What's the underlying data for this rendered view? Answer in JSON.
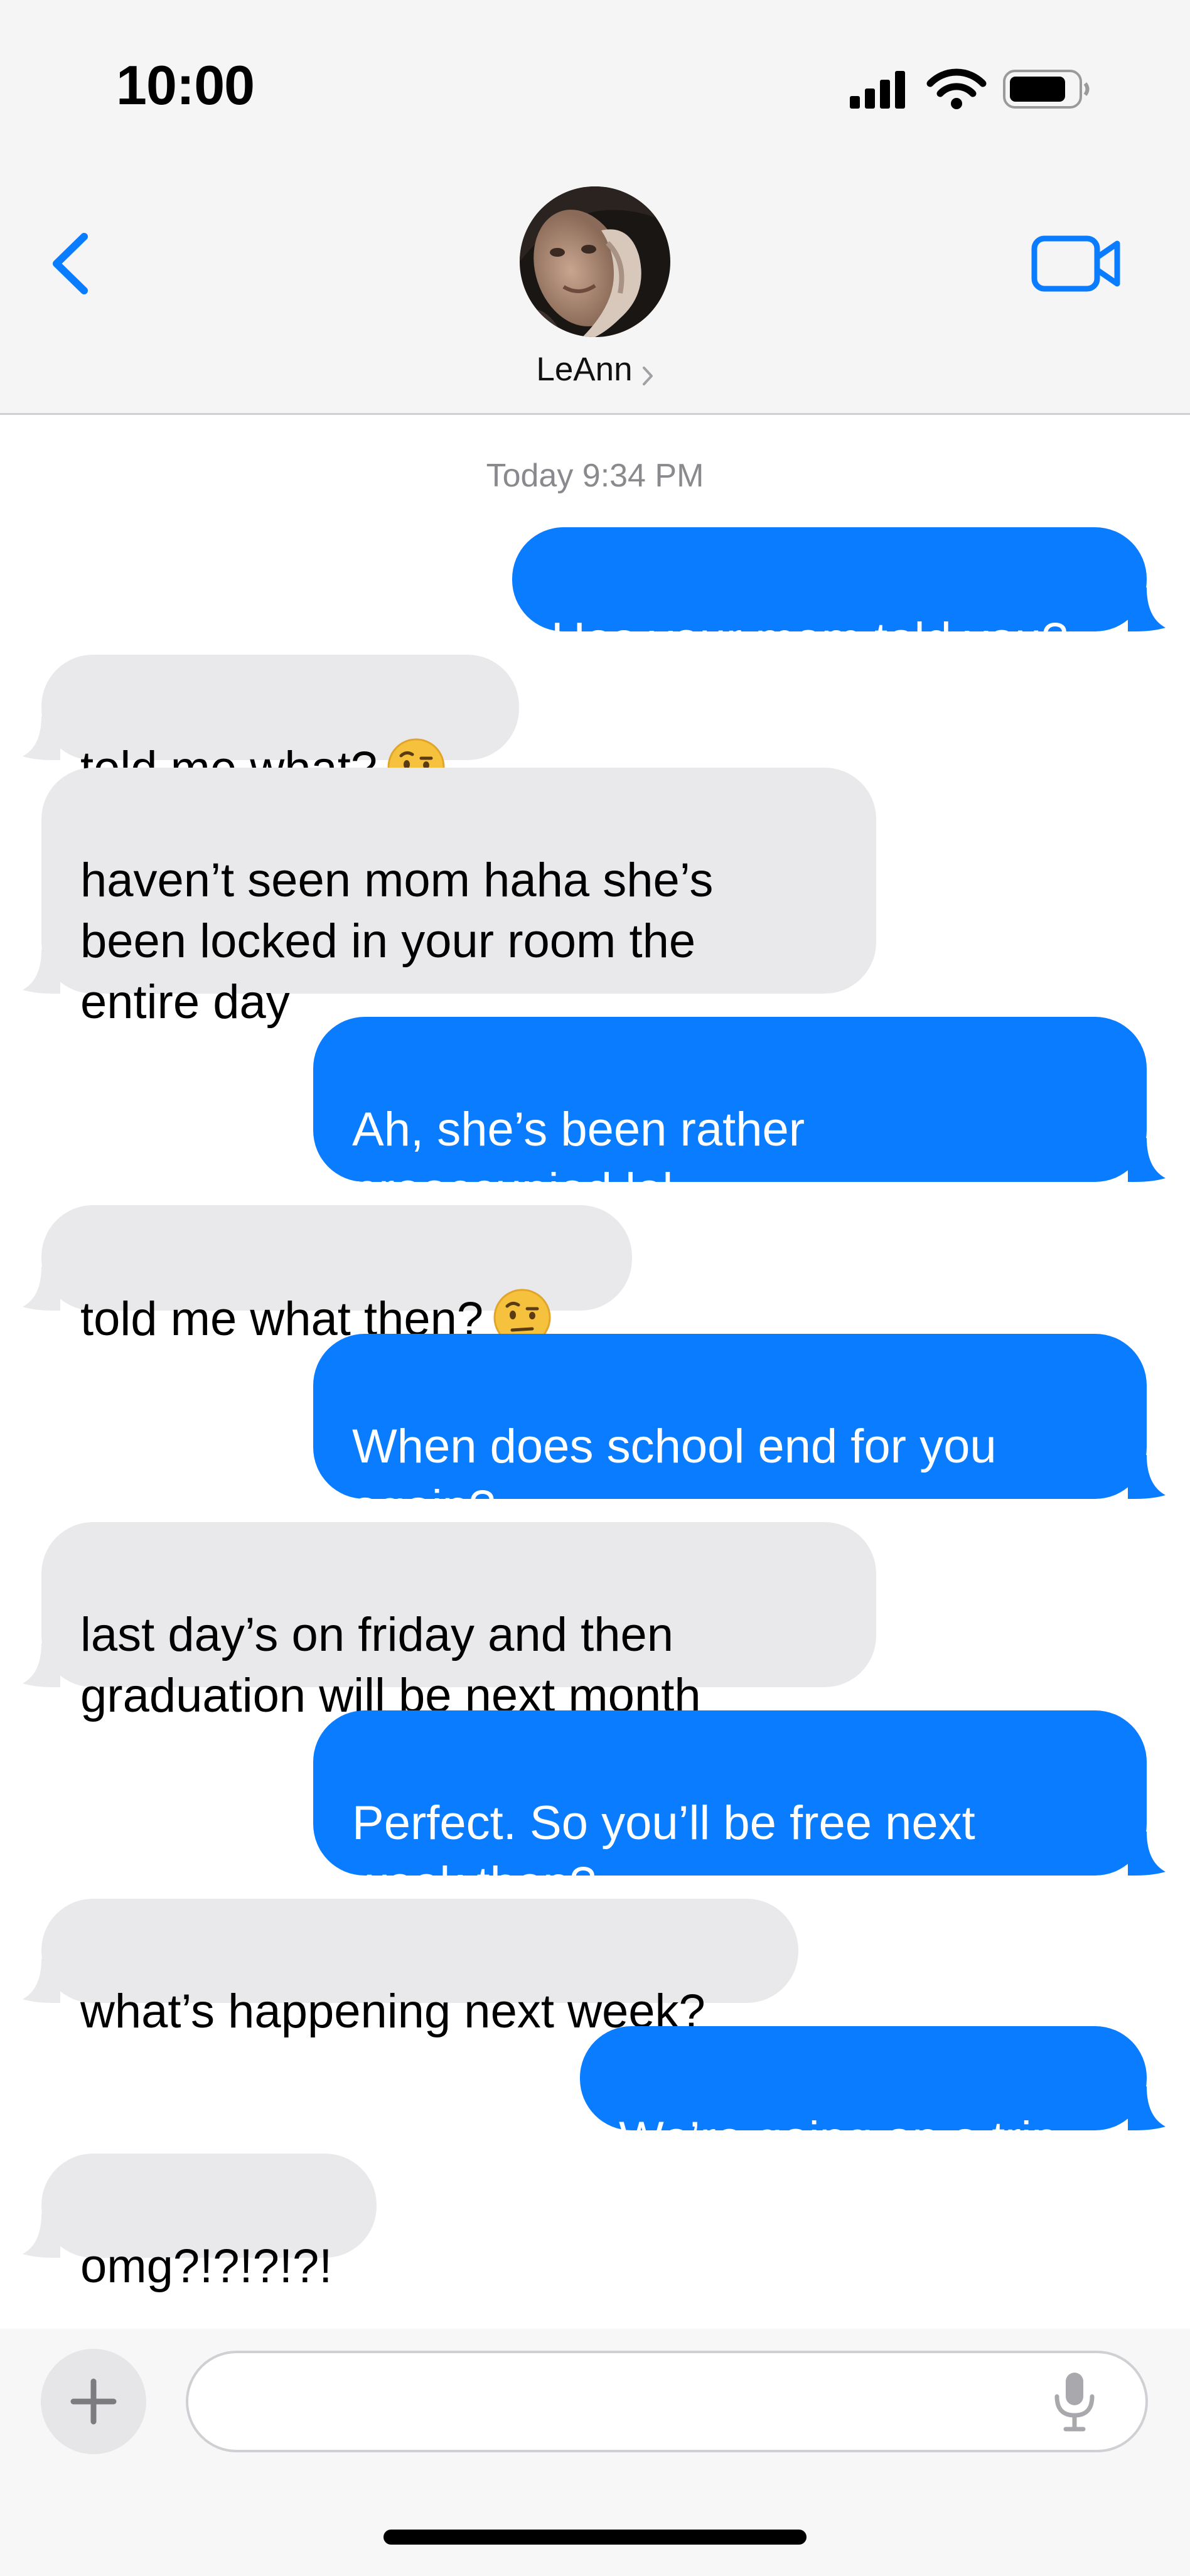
{
  "status_bar": {
    "time": "10:00",
    "icons": [
      "cellular-signal-icon",
      "wifi-icon",
      "battery-icon"
    ]
  },
  "header": {
    "back_icon": "chevron-left-icon",
    "contact_name": "LeAnn",
    "video_icon": "video-camera-icon"
  },
  "thread": {
    "timestamp": "Today 9:34 PM",
    "messages": [
      {
        "sender": "me",
        "text": "Has your mom told you?"
      },
      {
        "sender": "them",
        "text": "told me what?",
        "emoji": "raised-eyebrow-face"
      },
      {
        "sender": "them",
        "text": "haven’t seen mom haha she’s\nbeen locked in your room the\nentire day"
      },
      {
        "sender": "me",
        "text": "Ah, she’s been rather\npreoccupied lol."
      },
      {
        "sender": "them",
        "text": "told me what then?",
        "emoji": "raised-eyebrow-face"
      },
      {
        "sender": "me",
        "text": "When does school end for you\nagain?"
      },
      {
        "sender": "them",
        "text": "last day’s on friday and then\ngraduation will be next month"
      },
      {
        "sender": "me",
        "text": "Perfect. So you’ll be free next\nweek then?"
      },
      {
        "sender": "them",
        "text": "what’s happening next week?"
      },
      {
        "sender": "me",
        "text": "We’re going on a trip."
      },
      {
        "sender": "them",
        "text": "omg?!?!?!?!"
      }
    ]
  },
  "compose": {
    "plus_icon": "plus-icon",
    "input_value": "",
    "mic_icon": "microphone-icon"
  },
  "colors": {
    "sent_bubble": "#0a7cff",
    "received_bubble": "#e9e9eb",
    "accent": "#0a7cff"
  }
}
